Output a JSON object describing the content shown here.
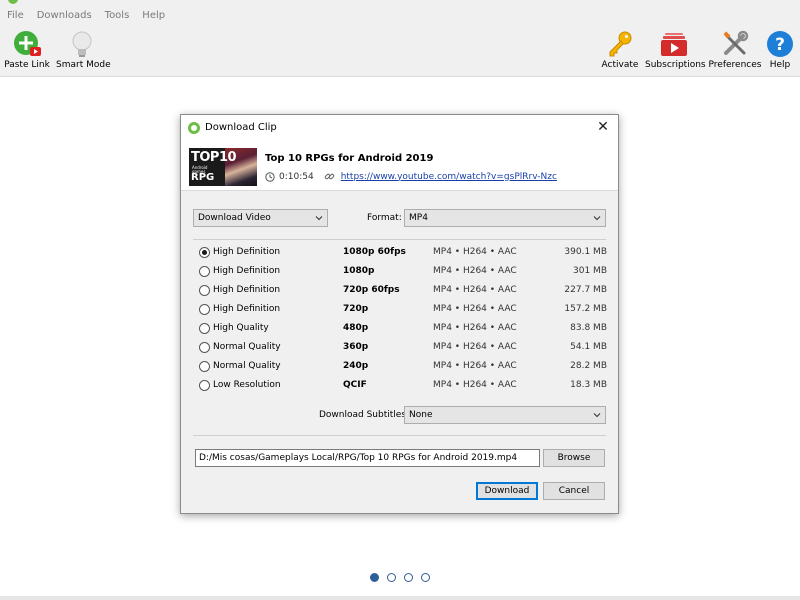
{
  "menu": [
    "File",
    "Downloads",
    "Tools",
    "Help"
  ],
  "toolbar": {
    "paste_link": "Paste Link",
    "smart_mode": "Smart Mode",
    "activate": "Activate",
    "subscriptions": "Subscriptions",
    "preferences": "Preferences",
    "help": "Help"
  },
  "dialog": {
    "title": "Download Clip",
    "clip": {
      "thumb_title": "TOP10",
      "thumb_sub": "Android games",
      "thumb_rpg": "RPG",
      "title": "Top 10 RPGs for Android 2019",
      "duration": "0:10:54",
      "url": "https://www.youtube.com/watch?v=gsPlRrv-Nzc"
    },
    "download_type": "Download Video",
    "format_label": "Format:",
    "format_value": "MP4",
    "options": [
      {
        "quality": "High Definition",
        "resolution": "1080p 60fps",
        "format": "MP4 • H264 • AAC",
        "size": "390.1 MB",
        "checked": true
      },
      {
        "quality": "High Definition",
        "resolution": "1080p",
        "format": "MP4 • H264 • AAC",
        "size": "301 MB",
        "checked": false
      },
      {
        "quality": "High Definition",
        "resolution": "720p 60fps",
        "format": "MP4 • H264 • AAC",
        "size": "227.7 MB",
        "checked": false
      },
      {
        "quality": "High Definition",
        "resolution": "720p",
        "format": "MP4 • H264 • AAC",
        "size": "157.2 MB",
        "checked": false
      },
      {
        "quality": "High Quality",
        "resolution": "480p",
        "format": "MP4 • H264 • AAC",
        "size": "83.8 MB",
        "checked": false
      },
      {
        "quality": "Normal Quality",
        "resolution": "360p",
        "format": "MP4 • H264 • AAC",
        "size": "54.1 MB",
        "checked": false
      },
      {
        "quality": "Normal Quality",
        "resolution": "240p",
        "format": "MP4 • H264 • AAC",
        "size": "28.2 MB",
        "checked": false
      },
      {
        "quality": "Low Resolution",
        "resolution": "QCIF",
        "format": "MP4 • H264 • AAC",
        "size": "18.3 MB",
        "checked": false
      }
    ],
    "subtitles_label": "Download Subtitles:",
    "subtitles_value": "None",
    "save_path": "D:/Mis cosas/Gameplays Local/RPG/Top 10 RPGs for Android 2019.mp4",
    "browse_label": "Browse",
    "download_label": "Download",
    "cancel_label": "Cancel"
  },
  "pager": {
    "count": 4,
    "active": 0
  },
  "colors": {
    "accent": "#0078d7",
    "link": "#1a3fa8",
    "pager": "#2d5f9a",
    "brand_green": "#6dbe45"
  }
}
